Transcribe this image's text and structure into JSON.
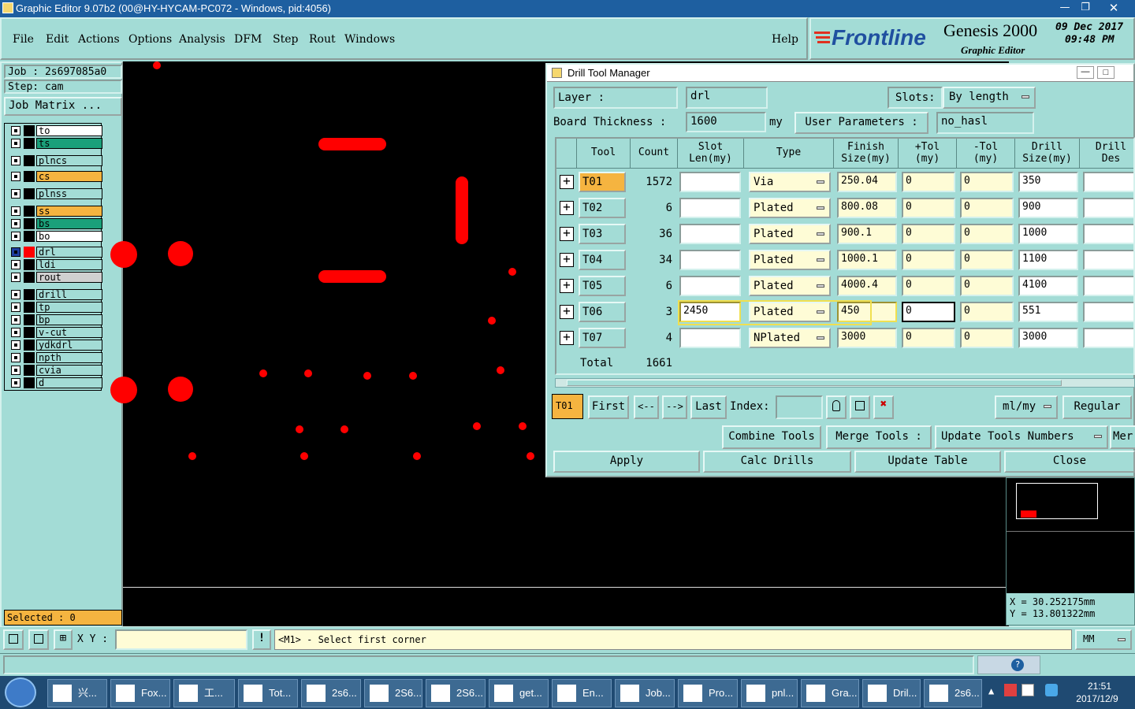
{
  "window": {
    "title": "Graphic Editor 9.07b2 (00@HY-HYCAM-PC072 - Windows, pid:4056)"
  },
  "menu": [
    "File",
    "Edit",
    "Actions",
    "Options",
    "Analysis",
    "DFM",
    "Step",
    "Rout",
    "Windows"
  ],
  "help": "Help",
  "brand": {
    "logo": "Frontline",
    "product": "Genesis 2000",
    "subtitle": "Graphic Editor",
    "date": "09 Dec 2017",
    "time": "09:48 PM"
  },
  "left": {
    "job": "Job : 2s697085a0",
    "step": "Step: cam",
    "job_matrix": "Job Matrix ...",
    "layers": [
      {
        "name": "to",
        "color": "#ffffff"
      },
      {
        "name": "ts",
        "color": "#1aa07a"
      },
      {
        "name": "plncs",
        "color": "#a3dcd6"
      },
      {
        "name": "cs",
        "color": "#f5b440"
      },
      {
        "name": "plnss",
        "color": "#a3dcd6"
      },
      {
        "name": "ss",
        "color": "#f5b440"
      },
      {
        "name": "bs",
        "color": "#1aa07a"
      },
      {
        "name": "bo",
        "color": "#ffffff"
      },
      {
        "name": "drl",
        "color": "#a3dcd6"
      },
      {
        "name": "ldi",
        "color": "#a3dcd6"
      },
      {
        "name": "rout",
        "color": "#d0d0d0"
      },
      {
        "name": "drill",
        "color": "#a3dcd6"
      },
      {
        "name": "tp",
        "color": "#a3dcd6"
      },
      {
        "name": "bp",
        "color": "#a3dcd6"
      },
      {
        "name": "v-cut",
        "color": "#a3dcd6"
      },
      {
        "name": "ydkdrl",
        "color": "#a3dcd6"
      },
      {
        "name": "npth",
        "color": "#a3dcd6"
      },
      {
        "name": "cvia",
        "color": "#a3dcd6"
      },
      {
        "name": "d",
        "color": "#a3dcd6"
      }
    ],
    "selected": "Selected : 0"
  },
  "dialog": {
    "title": "Drill Tool Manager",
    "layer_label": "Layer :",
    "layer_value": "drl",
    "slots_label": "Slots:",
    "slots_value": "By length",
    "board_label": "Board Thickness :",
    "board_value": "1600",
    "board_unit": "my",
    "user_params_label": "User Parameters :",
    "user_params_value": "no_hasl",
    "headers": [
      "Tool",
      "Count",
      "Slot Len(my)",
      "Type",
      "Finish Size(my)",
      "+Tol (my)",
      "-Tol (my)",
      "Drill Size(my)",
      "Drill Des"
    ],
    "rows": [
      {
        "tool": "T01",
        "count": "1572",
        "slot": "",
        "type": "Via",
        "finish": "250.04",
        "ptol": "0",
        "mtol": "0",
        "drill": "350",
        "des": ""
      },
      {
        "tool": "T02",
        "count": "6",
        "slot": "",
        "type": "Plated",
        "finish": "800.08",
        "ptol": "0",
        "mtol": "0",
        "drill": "900",
        "des": ""
      },
      {
        "tool": "T03",
        "count": "36",
        "slot": "",
        "type": "Plated",
        "finish": "900.1",
        "ptol": "0",
        "mtol": "0",
        "drill": "1000",
        "des": ""
      },
      {
        "tool": "T04",
        "count": "34",
        "slot": "",
        "type": "Plated",
        "finish": "1000.1",
        "ptol": "0",
        "mtol": "0",
        "drill": "1100",
        "des": ""
      },
      {
        "tool": "T05",
        "count": "6",
        "slot": "",
        "type": "Plated",
        "finish": "4000.4",
        "ptol": "0",
        "mtol": "0",
        "drill": "4100",
        "des": ""
      },
      {
        "tool": "T06",
        "count": "3",
        "slot": "2450",
        "type": "Plated",
        "finish": "450",
        "ptol": "0",
        "mtol": "0",
        "drill": "551",
        "des": ""
      },
      {
        "tool": "T07",
        "count": "4",
        "slot": "",
        "type": "NPlated",
        "finish": "3000",
        "ptol": "0",
        "mtol": "0",
        "drill": "3000",
        "des": ""
      }
    ],
    "total_label": "Total",
    "total_value": "1661",
    "nav": {
      "current": "T01",
      "first": "First",
      "prev": "<--",
      "next": "-->",
      "last": "Last",
      "index": "Index:",
      "units": "ml/my",
      "regular": "Regular"
    },
    "actions": {
      "combine": "Combine Tools",
      "merge": "Merge Tools :",
      "update_numbers": "Update Tools Numbers",
      "merge_more": "Mer"
    },
    "bottom": {
      "apply": "Apply",
      "calc": "Calc Drills",
      "update": "Update Table",
      "close": "Close"
    }
  },
  "coords": {
    "x": "X = 30.252175mm",
    "y": "Y = 13.801322mm"
  },
  "status": {
    "xy_label": "X Y :",
    "message": "<M1> - Select first corner",
    "units": "MM"
  },
  "taskbar": {
    "items": [
      "兴...",
      "Fox...",
      "工...",
      "Tot...",
      "2s6...",
      "2S6...",
      "2S6...",
      "get...",
      "En...",
      "Job...",
      "Pro...",
      "pnl...",
      "Gra...",
      "Dril...",
      "2s6..."
    ],
    "time": "21:51",
    "date": "2017/12/9"
  }
}
